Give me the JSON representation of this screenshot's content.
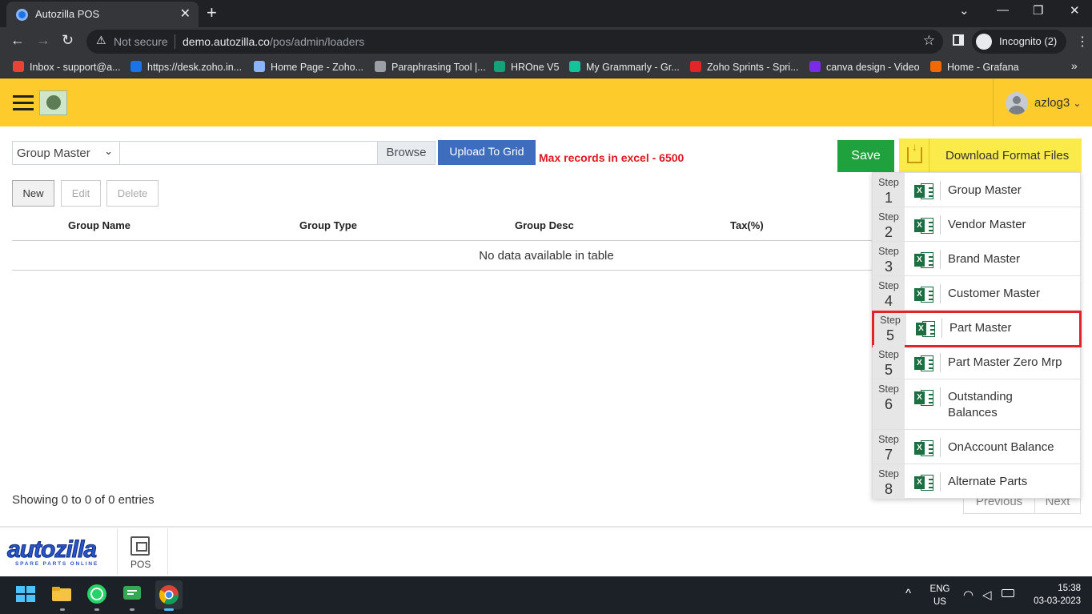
{
  "browser": {
    "tab_title": "Autozilla POS",
    "tab_close": "✕",
    "new_tab": "+",
    "window_controls": [
      "⌄",
      "—",
      "❐",
      "✕"
    ],
    "omnibox": {
      "security_label": "Not secure",
      "url_host": "demo.autozilla.co",
      "url_path": "/pos/admin/loaders"
    },
    "incognito_label": "Incognito (2)",
    "bookmarks": [
      {
        "label": "Inbox - support@a...",
        "color": "#ea4335"
      },
      {
        "label": "https://desk.zoho.in...",
        "color": "#1a73e8"
      },
      {
        "label": "Home Page - Zoho...",
        "color": "#8ab4f8"
      },
      {
        "label": "Paraphrasing Tool |...",
        "color": "#9aa0a6"
      },
      {
        "label": "HROne V5",
        "color": "#12a37b"
      },
      {
        "label": "My Grammarly - Gr...",
        "color": "#15c39a"
      },
      {
        "label": "Zoho Sprints - Spri...",
        "color": "#e42527"
      },
      {
        "label": "canva design - Video",
        "color": "#7d2ae8"
      },
      {
        "label": "Home - Grafana",
        "color": "#f46800"
      }
    ],
    "bookmarks_more": "»"
  },
  "header": {
    "username": "azlog3",
    "user_chevron": "⌄"
  },
  "loader": {
    "master_select": "Group Master",
    "browse_label": "Browse",
    "upload_label": "Upload To Grid",
    "max_records": "Max records in excel - 6500",
    "save_label": "Save",
    "download_label": "Download Format Files"
  },
  "actions": {
    "new_label": "New",
    "edit_label": "Edit",
    "delete_label": "Delete"
  },
  "table": {
    "columns": [
      "Group Name",
      "Group Type",
      "Group Desc",
      "Tax(%)"
    ],
    "empty_message": "No data available in table",
    "info": "Showing 0 to 0 of 0 entries",
    "previous_label": "Previous",
    "next_label": "Next"
  },
  "download_menu": {
    "step_word": "Step",
    "items": [
      {
        "step": "1",
        "label": "Group Master"
      },
      {
        "step": "2",
        "label": "Vendor Master"
      },
      {
        "step": "3",
        "label": "Brand Master"
      },
      {
        "step": "4",
        "label": "Customer Master"
      },
      {
        "step": "5",
        "label": "Part Master",
        "highlighted": true
      },
      {
        "step": "5",
        "label": "Part Master Zero Mrp"
      },
      {
        "step": "6",
        "label": "Outstanding Balances"
      },
      {
        "step": "7",
        "label": "OnAccount Balance"
      },
      {
        "step": "8",
        "label": "Alternate Parts"
      }
    ]
  },
  "footer": {
    "brand_name": "autozilla",
    "brand_tagline": "SPARE PARTS ONLINE",
    "pos_label": "POS"
  },
  "taskbar": {
    "lang_line1": "ENG",
    "lang_line2": "US",
    "time": "15:38",
    "date": "03-03-2023"
  },
  "colors": {
    "header_bg": "#fdcb2c",
    "save_green": "#1fa23e",
    "upload_blue": "#3e6dbd",
    "download_yellow": "#fbeb4a",
    "warning_red": "#e0181e",
    "highlight_red": "#e3222a",
    "excel_green": "#1d6f42"
  }
}
